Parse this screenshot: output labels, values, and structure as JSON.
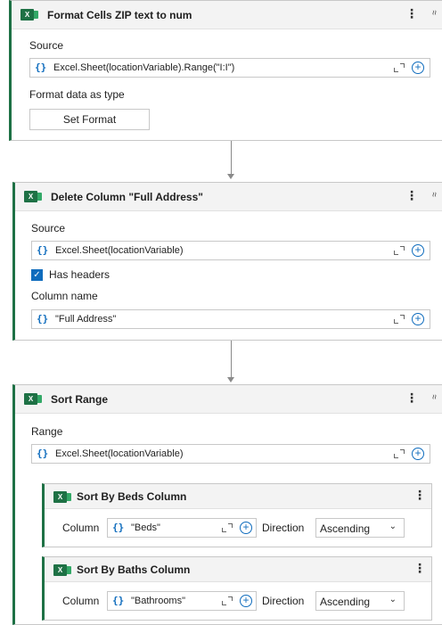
{
  "actions": [
    {
      "title": "Format Cells ZIP text to num",
      "source_label": "Source",
      "source_value": "Excel.Sheet(locationVariable).Range(\"I:I\")",
      "format_label": "Format data as type",
      "format_button": "Set Format"
    },
    {
      "title": "Delete Column \"Full Address\"",
      "source_label": "Source",
      "source_value": "Excel.Sheet(locationVariable)",
      "has_headers_label": "Has headers",
      "column_name_label": "Column name",
      "column_name_value": "\"Full Address\""
    },
    {
      "title": "Sort Range",
      "range_label": "Range",
      "range_value": "Excel.Sheet(locationVariable)",
      "sorts": [
        {
          "title": "Sort By Beds Column",
          "column_label": "Column",
          "column_value": "\"Beds\"",
          "direction_label": "Direction",
          "direction_value": "Ascending"
        },
        {
          "title": "Sort By Baths Column",
          "column_label": "Column",
          "column_value": "\"Bathrooms\"",
          "direction_label": "Direction",
          "direction_value": "Ascending"
        }
      ]
    }
  ],
  "common": {
    "expression_brace": "{}",
    "kebab": "⋮",
    "collapse": "≈",
    "plus": "+",
    "check": "✓",
    "excel_badge": "X",
    "chevron": "⌄"
  },
  "colors": {
    "accent": "#1e7145",
    "brace": "#0f6cbd"
  }
}
